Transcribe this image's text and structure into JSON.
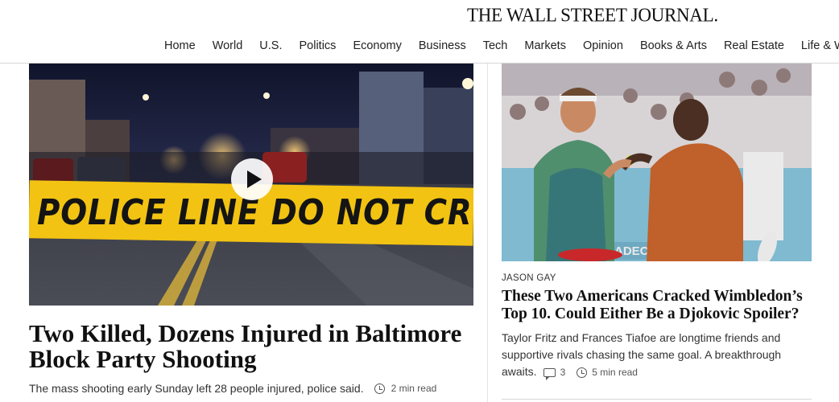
{
  "masthead": {
    "logo": "THE WALL STREET JOURNAL."
  },
  "nav": {
    "items": [
      "Home",
      "World",
      "U.S.",
      "Politics",
      "Economy",
      "Business",
      "Tech",
      "Markets",
      "Opinion",
      "Books & Arts",
      "Real Estate",
      "Life & W"
    ]
  },
  "lead_story": {
    "image_text": "POLICE LINE DO NOT CROSS",
    "headline": "Two Killed, Dozens Injured in Baltimore Block Party Shooting",
    "summary": "The mass shooting early Sunday left 28 people injured, police said.",
    "read_time": "2 min read"
  },
  "side_story": {
    "kicker": "JASON GAY",
    "headline": "These Two Americans Cracked Wimbledon’s Top 10. Could Either Be a Djokovic Spoiler?",
    "summary": "Taylor Fritz and Frances Tiafoe are longtime friends and supportive rivals chasing the same goal. A breakthrough awaits.",
    "comments": "3",
    "read_time": "5 min read",
    "image_text": "ADECCO"
  },
  "colors": {
    "tape_yellow": "#f2c312",
    "night_sky": "#141a33"
  }
}
